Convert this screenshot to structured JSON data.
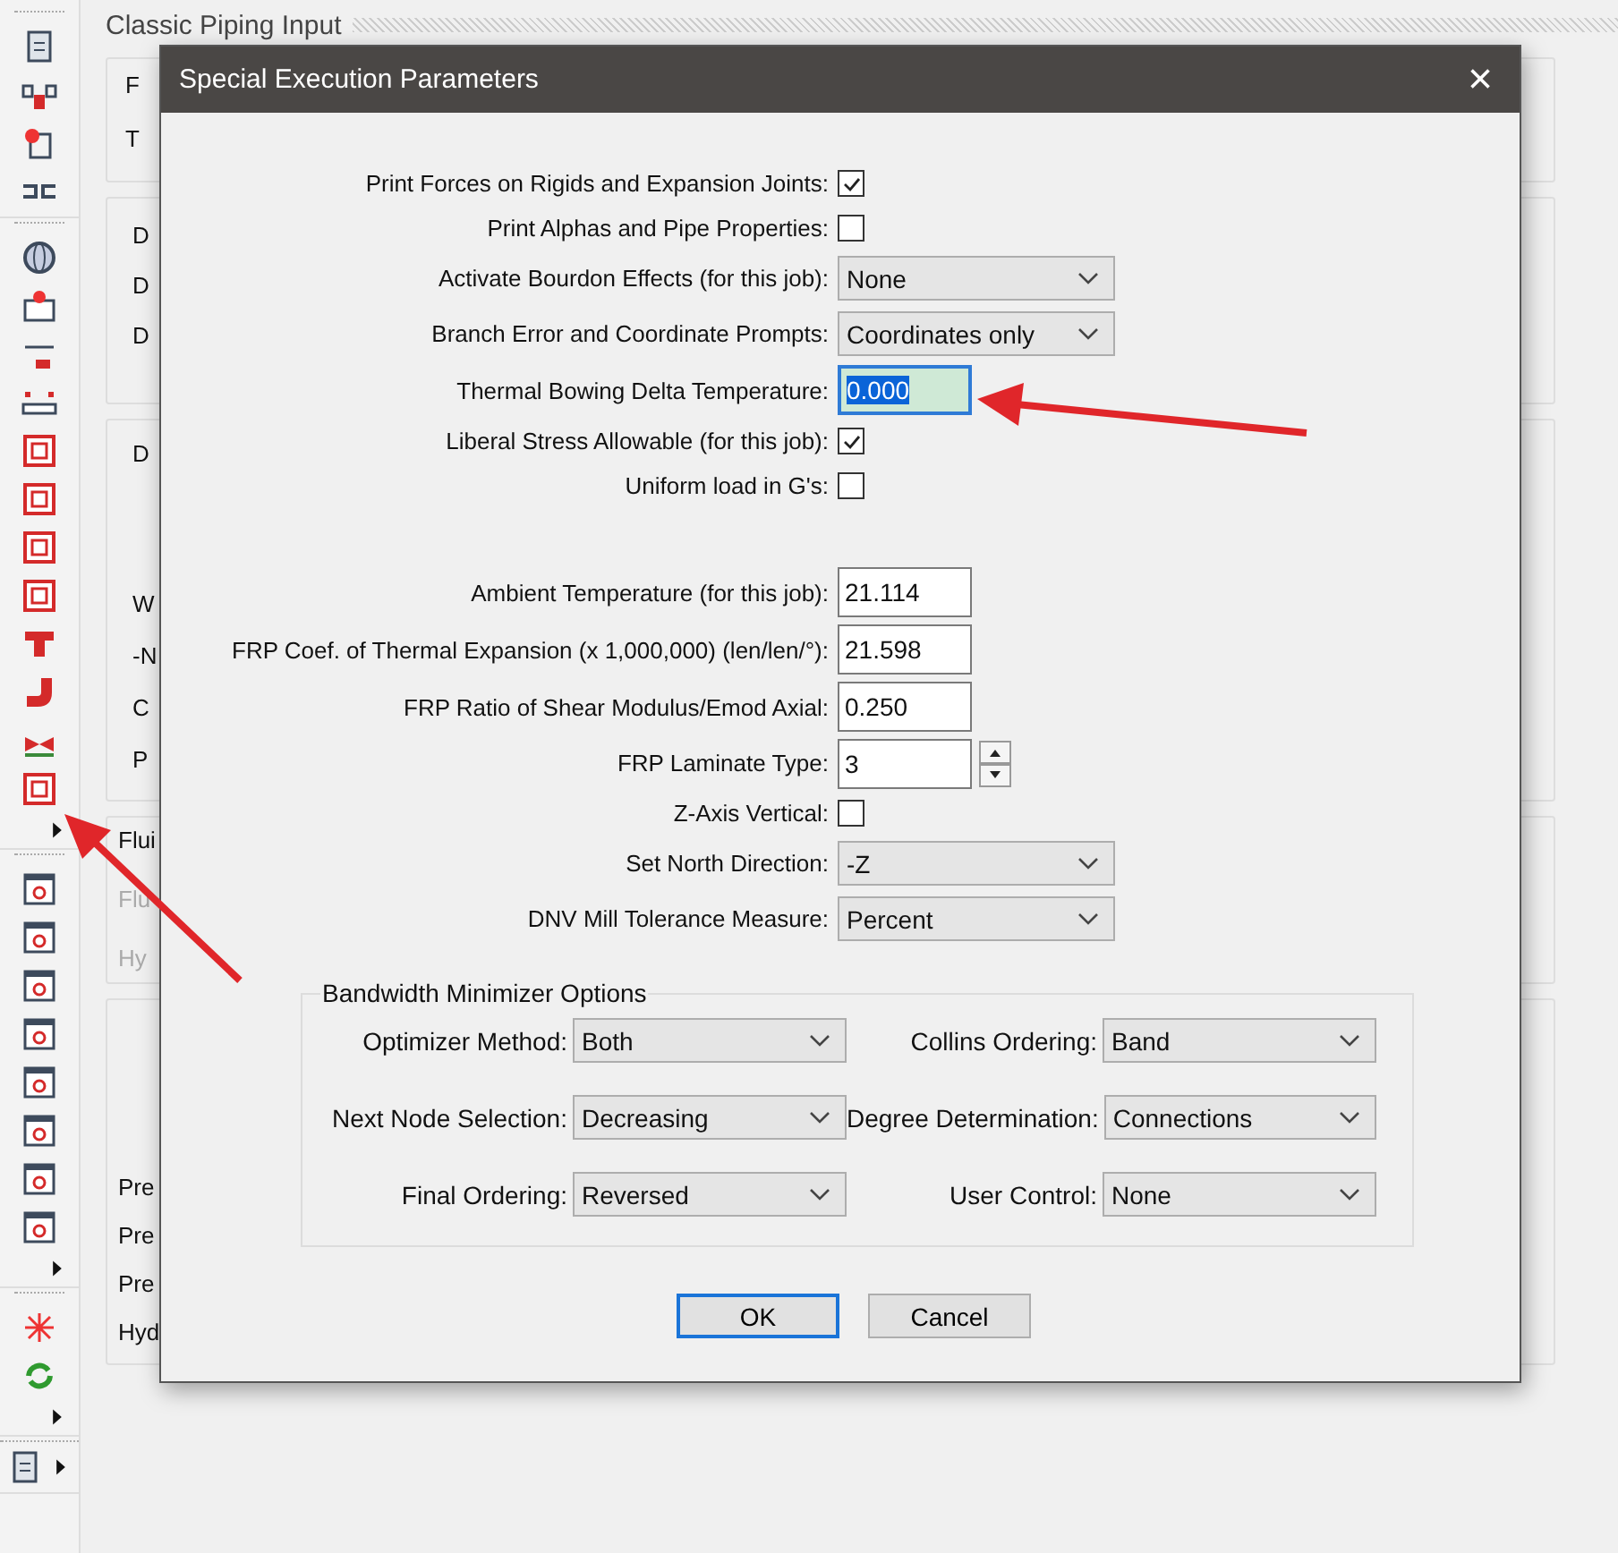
{
  "app": {
    "title": "Classic Piping Input",
    "groups": [
      {
        "labels": [
          {
            "text": "F",
            "disabled": false
          },
          {
            "text": "T",
            "disabled": false
          }
        ]
      },
      {
        "labels": [
          {
            "text": "D",
            "disabled": false
          },
          {
            "text": "D",
            "disabled": false
          },
          {
            "text": "D",
            "disabled": false
          }
        ]
      },
      {
        "labels": [
          {
            "text": "D",
            "disabled": false
          },
          {
            "text": "W",
            "disabled": false
          },
          {
            "text": "-N",
            "disabled": false
          },
          {
            "text": "C",
            "disabled": false
          },
          {
            "text": "P",
            "disabled": false
          }
        ]
      },
      {
        "labels": [
          {
            "text": "Flui",
            "disabled": false
          },
          {
            "text": "Flu",
            "disabled": true
          },
          {
            "text": "Hy",
            "disabled": true
          }
        ]
      },
      {
        "labels": [
          {
            "text": "Pre",
            "disabled": false
          },
          {
            "text": "Pre",
            "disabled": false
          },
          {
            "text": "Pre",
            "disabled": false
          },
          {
            "text": "Hyd",
            "disabled": false
          }
        ]
      }
    ]
  },
  "dialog": {
    "title": "Special Execution Parameters",
    "close": "×",
    "upper_rows": [
      {
        "label": "Print Forces on Rigids and Expansion Joints:",
        "kind": "checkbox",
        "checked": true
      },
      {
        "label": "Print Alphas and Pipe Properties:",
        "kind": "checkbox",
        "checked": false
      },
      {
        "label": "Activate Bourdon Effects (for this job):",
        "kind": "dropdown",
        "value": "None"
      },
      {
        "label": "Branch Error and Coordinate Prompts:",
        "kind": "dropdown",
        "value": "Coordinates only"
      },
      {
        "label": "Thermal Bowing Delta Temperature:",
        "kind": "text",
        "value": "0.000",
        "highlighted": true
      },
      {
        "label": "Liberal Stress Allowable (for this job):",
        "kind": "checkbox",
        "checked": true
      },
      {
        "label": "Uniform load in G's:",
        "kind": "checkbox",
        "checked": false
      }
    ],
    "lower_rows": [
      {
        "label": "Ambient Temperature (for this job):",
        "kind": "text",
        "value": "21.114",
        "highlighted": false
      },
      {
        "label": "FRP Coef. of Thermal Expansion (x 1,000,000) (len/len/°):",
        "kind": "text",
        "value": "21.598",
        "highlighted": false
      },
      {
        "label": "FRP Ratio of Shear Modulus/Emod Axial:",
        "kind": "text",
        "value": "0.250",
        "highlighted": false
      },
      {
        "label": "FRP Laminate Type:",
        "kind": "spin",
        "value": "3"
      },
      {
        "label": "Z-Axis Vertical:",
        "kind": "checkbox",
        "checked": false
      },
      {
        "label": "Set North Direction:",
        "kind": "dropdown",
        "value": "-Z"
      },
      {
        "label": "DNV Mill Tolerance Measure:",
        "kind": "dropdown",
        "value": "Percent"
      }
    ],
    "bandwidth": {
      "title": "Bandwidth Minimizer Options",
      "fields": [
        {
          "label": "Optimizer Method:",
          "value": "Both"
        },
        {
          "label": "Collins Ordering:",
          "value": "Band"
        },
        {
          "label": "Next Node Selection:",
          "value": "Decreasing"
        },
        {
          "label": "Degree Determination:",
          "value": "Connections"
        },
        {
          "label": "Final Ordering:",
          "value": "Reversed"
        },
        {
          "label": "User Control:",
          "value": "None"
        }
      ]
    },
    "buttons": [
      {
        "label": "OK",
        "default": true
      },
      {
        "label": "Cancel",
        "default": false
      }
    ]
  }
}
